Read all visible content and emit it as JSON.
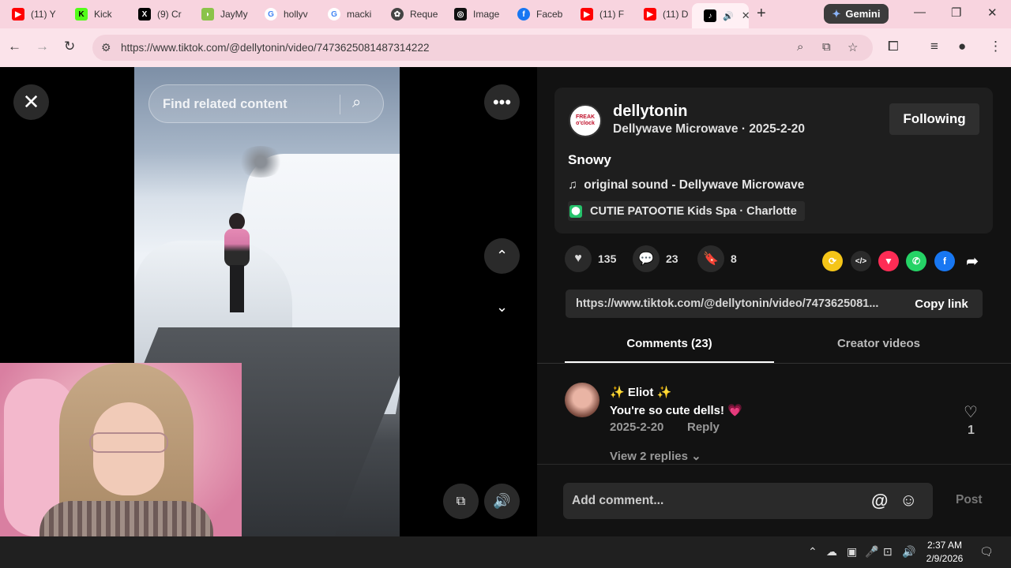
{
  "browser": {
    "tabs": [
      {
        "title": "(11) Y",
        "icon": "youtube-icon",
        "color": "#ff0000"
      },
      {
        "title": "Kick",
        "icon": "kick-icon",
        "color": "#53fc18"
      },
      {
        "title": "(9) Cr",
        "icon": "x-icon",
        "color": "#000000"
      },
      {
        "title": "JayMy",
        "icon": "extension-icon",
        "color": "#8bc34a"
      },
      {
        "title": "hollyv",
        "icon": "google-icon",
        "color": "#4285f4"
      },
      {
        "title": "macki",
        "icon": "google-icon",
        "color": "#4285f4"
      },
      {
        "title": "Reque",
        "icon": "openai-icon",
        "color": "#444444"
      },
      {
        "title": "Image",
        "icon": "app-icon",
        "color": "#111111"
      },
      {
        "title": "Faceb",
        "icon": "facebook-icon",
        "color": "#1877f2"
      },
      {
        "title": "(11) F",
        "icon": "youtube-icon",
        "color": "#ff0000"
      },
      {
        "title": "(11) D",
        "icon": "youtube-icon",
        "color": "#ff0000"
      },
      {
        "title": "",
        "icon": "tiktok-icon",
        "color": "#000000",
        "active": true
      }
    ],
    "gemini_label": "Gemini",
    "url": "https://www.tiktok.com/@dellytonin/video/7473625081487314222"
  },
  "player": {
    "search_placeholder": "Find related content"
  },
  "post": {
    "username": "dellytonin",
    "display_name": "Dellywave Microwave",
    "date": "2025-2-20",
    "subline_sep": " · ",
    "follow_label": "Following",
    "avatar_text": "FREAK o'clock",
    "description": "Snowy",
    "sound": "original sound - Dellywave Microwave",
    "location": "CUTIE PATOOTIE Kids Spa · Charlotte",
    "likes": "135",
    "comments": "23",
    "saves": "8",
    "link": "https://www.tiktok.com/@dellytonin/video/7473625081...",
    "copy_label": "Copy link"
  },
  "tabs": {
    "comments": "Comments (23)",
    "creator": "Creator videos"
  },
  "comment": {
    "name": "✨ Eliot ✨",
    "text": "You're so cute dells! 💗",
    "date": "2025-2-20",
    "reply": "Reply",
    "likes": "1",
    "view_replies": "View 2 replies ⌄"
  },
  "composer": {
    "placeholder": "Add comment...",
    "post_label": "Post"
  },
  "taskbar": {
    "time": "2:37 AM",
    "date": "2/9/2026"
  }
}
